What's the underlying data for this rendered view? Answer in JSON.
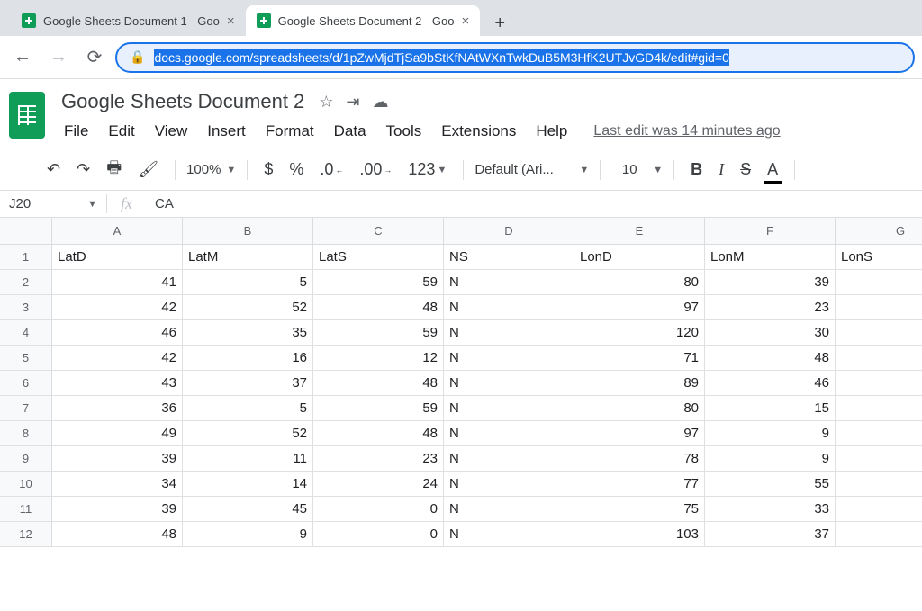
{
  "browser": {
    "tabs": [
      {
        "title": "Google Sheets Document 1 - Goo"
      },
      {
        "title": "Google Sheets Document 2 - Goo"
      }
    ],
    "url": "docs.google.com/spreadsheets/d/1pZwMjdTjSa9bStKfNAtWXnTwkDuB5M3HfK2UTJvGD4k/edit#gid=0"
  },
  "doc": {
    "title": "Google Sheets Document 2",
    "last_edit": "Last edit was 14 minutes ago"
  },
  "menu": [
    "File",
    "Edit",
    "View",
    "Insert",
    "Format",
    "Data",
    "Tools",
    "Extensions",
    "Help"
  ],
  "toolbar": {
    "zoom": "100%",
    "font": "Default (Ari...",
    "font_size": "10"
  },
  "namebox": "J20",
  "formula": "CA",
  "columns": [
    "A",
    "B",
    "C",
    "D",
    "E",
    "F",
    "G"
  ],
  "headers": [
    "LatD",
    "LatM",
    "LatS",
    "NS",
    "LonD",
    "LonM",
    "LonS"
  ],
  "rows": [
    [
      41,
      5,
      59,
      "N",
      80,
      39,
      null
    ],
    [
      42,
      52,
      48,
      "N",
      97,
      23,
      null
    ],
    [
      46,
      35,
      59,
      "N",
      120,
      30,
      null
    ],
    [
      42,
      16,
      12,
      "N",
      71,
      48,
      null
    ],
    [
      43,
      37,
      48,
      "N",
      89,
      46,
      null
    ],
    [
      36,
      5,
      59,
      "N",
      80,
      15,
      null
    ],
    [
      49,
      52,
      48,
      "N",
      97,
      9,
      null
    ],
    [
      39,
      11,
      23,
      "N",
      78,
      9,
      null
    ],
    [
      34,
      14,
      24,
      "N",
      77,
      55,
      null
    ],
    [
      39,
      45,
      0,
      "N",
      75,
      33,
      null
    ],
    [
      48,
      9,
      0,
      "N",
      103,
      37,
      null
    ]
  ]
}
